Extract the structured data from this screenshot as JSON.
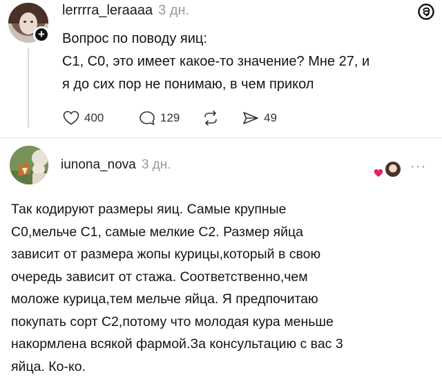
{
  "post": {
    "username": "lerrrra_leraaaa",
    "time": "3 дн.",
    "lines": [
      "Вопрос по поводу яиц:",
      "С1, С0, это имеет какое-то значение? Мне 27, и",
      "я до сих пор не понимаю, в чем прикол"
    ],
    "stats": {
      "likes": "400",
      "comments": "129",
      "shares": "49"
    }
  },
  "reply": {
    "username": "iunona_nova",
    "time": "3 дн.",
    "more": "···",
    "lines": [
      "Так кодируют размеры яиц. Самые крупные",
      "С0,мельче С1, самые мелкие С2. Размер яйца",
      "зависит от размера жопы курицы,который в свою",
      "очередь зависит от стажа. Соответственно,чем",
      "моложе курица,тем мельче яйца. Я предпочитаю",
      "покупать сорт С2,потому что молодая кура меньше",
      "накормлена всякой фармой.За консультацию с вас 3",
      "яйца. Ко-ко."
    ]
  },
  "colors": {
    "text": "#141414",
    "muted": "#9a9a9a",
    "like_accent": "#e0245e"
  },
  "icons": [
    "plus-icon",
    "threads-logo-icon",
    "heart-icon",
    "comment-icon",
    "repost-icon",
    "share-icon",
    "liked-heart-icon",
    "more-icon"
  ]
}
